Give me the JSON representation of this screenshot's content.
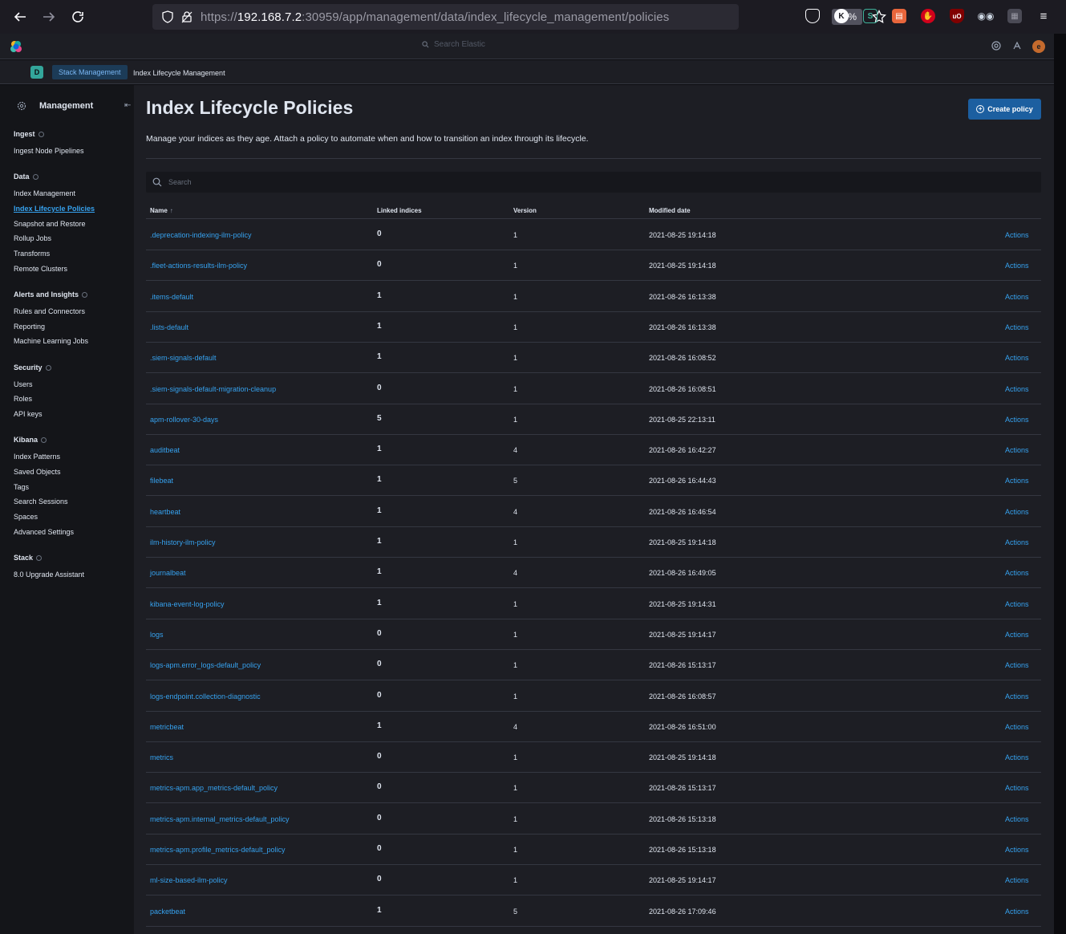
{
  "browser": {
    "url_prefix": "https://",
    "url_host": "192.168.7.2",
    "url_rest": ":30959/app/management/data/index_lifecycle_management/policies",
    "zoom": "67%"
  },
  "header": {
    "search_placeholder": "Search Elastic",
    "avatar_initial": "e"
  },
  "breadcrumb": {
    "space_initial": "D",
    "items": [
      "Stack Management",
      "Index Lifecycle Management"
    ]
  },
  "sidebar": {
    "title": "Management",
    "groups": [
      {
        "label": "Ingest",
        "items": [
          "Ingest Node Pipelines"
        ]
      },
      {
        "label": "Data",
        "items": [
          "Index Management",
          "Index Lifecycle Policies",
          "Snapshot and Restore",
          "Rollup Jobs",
          "Transforms",
          "Remote Clusters"
        ]
      },
      {
        "label": "Alerts and Insights",
        "items": [
          "Rules and Connectors",
          "Reporting",
          "Machine Learning Jobs"
        ]
      },
      {
        "label": "Security",
        "items": [
          "Users",
          "Roles",
          "API keys"
        ]
      },
      {
        "label": "Kibana",
        "items": [
          "Index Patterns",
          "Saved Objects",
          "Tags",
          "Search Sessions",
          "Spaces",
          "Advanced Settings"
        ]
      },
      {
        "label": "Stack",
        "items": [
          "8.0 Upgrade Assistant"
        ]
      }
    ],
    "active_item": "Index Lifecycle Policies"
  },
  "main": {
    "title": "Index Lifecycle Policies",
    "create_button": "Create policy",
    "description": "Manage your indices as they age. Attach a policy to automate when and how to transition an index through its lifecycle.",
    "search_placeholder": "Search",
    "columns": [
      "Name",
      "Linked indices",
      "Version",
      "Modified date"
    ],
    "sort_indicator": "↑",
    "rows": [
      {
        "name": ".deprecation-indexing-ilm-policy",
        "linked": "0",
        "version": "1",
        "modified": "2021-08-25 19:14:18",
        "action": "Actions"
      },
      {
        "name": ".fleet-actions-results-ilm-policy",
        "linked": "0",
        "version": "1",
        "modified": "2021-08-25 19:14:18",
        "action": "Actions"
      },
      {
        "name": ".items-default",
        "linked": "1",
        "version": "1",
        "modified": "2021-08-26 16:13:38",
        "action": "Actions"
      },
      {
        "name": ".lists-default",
        "linked": "1",
        "version": "1",
        "modified": "2021-08-26 16:13:38",
        "action": "Actions"
      },
      {
        "name": ".siem-signals-default",
        "linked": "1",
        "version": "1",
        "modified": "2021-08-26 16:08:52",
        "action": "Actions"
      },
      {
        "name": ".siem-signals-default-migration-cleanup",
        "linked": "0",
        "version": "1",
        "modified": "2021-08-26 16:08:51",
        "action": "Actions"
      },
      {
        "name": "apm-rollover-30-days",
        "linked": "5",
        "version": "1",
        "modified": "2021-08-25 22:13:11",
        "action": "Actions"
      },
      {
        "name": "auditbeat",
        "linked": "1",
        "version": "4",
        "modified": "2021-08-26 16:42:27",
        "action": "Actions"
      },
      {
        "name": "filebeat",
        "linked": "1",
        "version": "5",
        "modified": "2021-08-26 16:44:43",
        "action": "Actions"
      },
      {
        "name": "heartbeat",
        "linked": "1",
        "version": "4",
        "modified": "2021-08-26 16:46:54",
        "action": "Actions"
      },
      {
        "name": "ilm-history-ilm-policy",
        "linked": "1",
        "version": "1",
        "modified": "2021-08-25 19:14:18",
        "action": "Actions"
      },
      {
        "name": "journalbeat",
        "linked": "1",
        "version": "4",
        "modified": "2021-08-26 16:49:05",
        "action": "Actions"
      },
      {
        "name": "kibana-event-log-policy",
        "linked": "1",
        "version": "1",
        "modified": "2021-08-25 19:14:31",
        "action": "Actions"
      },
      {
        "name": "logs",
        "linked": "0",
        "version": "1",
        "modified": "2021-08-25 19:14:17",
        "action": "Actions"
      },
      {
        "name": "logs-apm.error_logs-default_policy",
        "linked": "0",
        "version": "1",
        "modified": "2021-08-26 15:13:17",
        "action": "Actions"
      },
      {
        "name": "logs-endpoint.collection-diagnostic",
        "linked": "0",
        "version": "1",
        "modified": "2021-08-26 16:08:57",
        "action": "Actions"
      },
      {
        "name": "metricbeat",
        "linked": "1",
        "version": "4",
        "modified": "2021-08-26 16:51:00",
        "action": "Actions"
      },
      {
        "name": "metrics",
        "linked": "0",
        "version": "1",
        "modified": "2021-08-25 19:14:18",
        "action": "Actions"
      },
      {
        "name": "metrics-apm.app_metrics-default_policy",
        "linked": "0",
        "version": "1",
        "modified": "2021-08-26 15:13:17",
        "action": "Actions"
      },
      {
        "name": "metrics-apm.internal_metrics-default_policy",
        "linked": "0",
        "version": "1",
        "modified": "2021-08-26 15:13:18",
        "action": "Actions"
      },
      {
        "name": "metrics-apm.profile_metrics-default_policy",
        "linked": "0",
        "version": "1",
        "modified": "2021-08-26 15:13:18",
        "action": "Actions"
      },
      {
        "name": "ml-size-based-ilm-policy",
        "linked": "0",
        "version": "1",
        "modified": "2021-08-25 19:14:17",
        "action": "Actions"
      },
      {
        "name": "packetbeat",
        "linked": "1",
        "version": "5",
        "modified": "2021-08-26 17:09:46",
        "action": "Actions"
      }
    ]
  }
}
